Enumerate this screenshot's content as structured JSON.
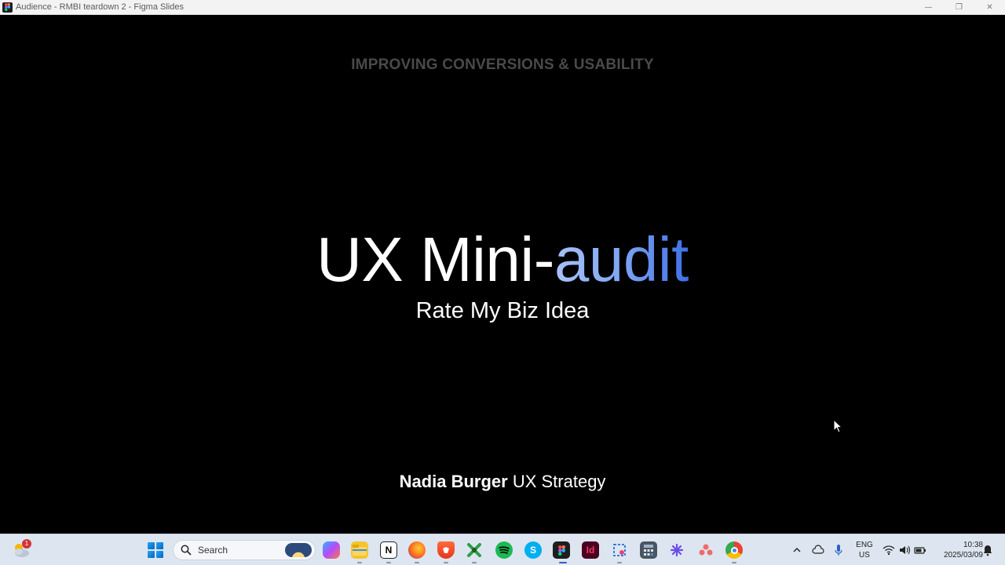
{
  "window": {
    "title": "Audience - RMBI teardown 2 - Figma Slides",
    "controls": {
      "minimize": "—",
      "restore": "❐",
      "close": "✕"
    }
  },
  "slide": {
    "eyebrow": "IMPROVING CONVERSIONS & USABILITY",
    "title_plain": "UX Mini-",
    "title_accent": "audit",
    "subtitle": "Rate My Biz Idea",
    "author_name": "Nadia Burger",
    "author_role": " UX Strategy",
    "accent_colors": [
      "#a8c2f7",
      "#7ea6f2",
      "#3f6fe8"
    ]
  },
  "taskbar": {
    "weather_badge": "1",
    "search_label": "Search",
    "apps": [
      {
        "name": "copilot",
        "label": ""
      },
      {
        "name": "file-explorer",
        "label": ""
      },
      {
        "name": "notion",
        "label": "N"
      },
      {
        "name": "firefox",
        "label": ""
      },
      {
        "name": "brave",
        "label": ""
      },
      {
        "name": "app-green",
        "label": ""
      },
      {
        "name": "spotify",
        "label": ""
      },
      {
        "name": "skype",
        "label": "S"
      },
      {
        "name": "figma",
        "label": ""
      },
      {
        "name": "indesign",
        "label": "Id"
      },
      {
        "name": "snipping-tool",
        "label": ""
      },
      {
        "name": "calculator",
        "label": ""
      },
      {
        "name": "app-purple",
        "label": ""
      },
      {
        "name": "asana",
        "label": ""
      },
      {
        "name": "chrome",
        "label": ""
      }
    ],
    "tray": {
      "lang_line1": "ENG",
      "lang_line2": "US",
      "time": "10:38",
      "date": "2025/03/09"
    }
  }
}
